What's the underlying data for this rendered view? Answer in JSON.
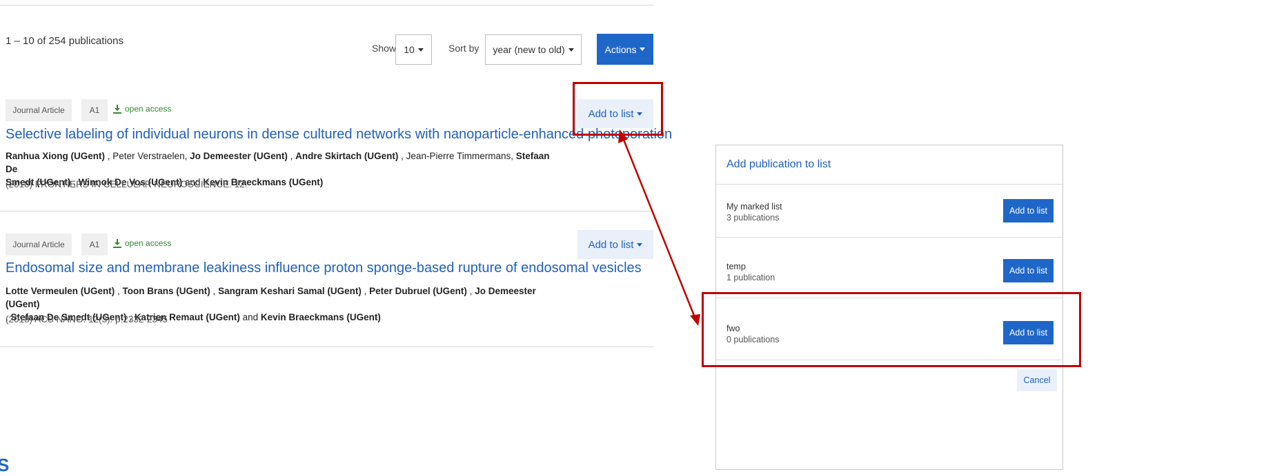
{
  "results": {
    "count_text": "1 – 10 of 254 publications",
    "show_label": "Show",
    "show_value": "10",
    "sort_label": "Sort by",
    "sort_value": "year (new to old)",
    "actions_label": "Actions"
  },
  "publications": [
    {
      "type": "Journal Article",
      "classification": "A1",
      "access": "open access",
      "add_to_list": "Add to list",
      "title": "Selective labeling of individual neurons in dense cultured networks with nanoparticle-enhanced photoporation",
      "authors_line1": [
        {
          "name": "Ranhua Xiong (UGent)",
          "ugent": true
        },
        {
          "name": " , ",
          "ugent": false
        },
        {
          "name": "Peter Verstraelen, ",
          "ugent": false
        },
        {
          "name": "Jo Demeester (UGent)",
          "ugent": true
        },
        {
          "name": " , ",
          "ugent": false
        },
        {
          "name": "Andre Skirtach (UGent)",
          "ugent": true
        },
        {
          "name": " , Jean-Pierre Timmermans, ",
          "ugent": false
        },
        {
          "name": "Stefaan De",
          "ugent": true
        }
      ],
      "authors_line2": [
        {
          "name": "Smedt (UGent)",
          "ugent": true
        },
        {
          "name": " , ",
          "ugent": false
        },
        {
          "name": "Winnok De Vos (UGent)",
          "ugent": true
        },
        {
          "name": " and ",
          "ugent": false
        },
        {
          "name": "Kevin Braeckmans (UGent)",
          "ugent": true
        }
      ],
      "source": "(2018) FRONTIERS IN CELLULAR NEUROSCIENCE. 12."
    },
    {
      "type": "Journal Article",
      "classification": "A1",
      "access": "open access",
      "add_to_list": "Add to list",
      "title": "Endosomal size and membrane leakiness influence proton sponge-based rupture of endosomal vesicles",
      "authors_line1": [
        {
          "name": "Lotte Vermeulen (UGent)",
          "ugent": true
        },
        {
          "name": " , ",
          "ugent": false
        },
        {
          "name": "Toon Brans (UGent)",
          "ugent": true
        },
        {
          "name": " , ",
          "ugent": false
        },
        {
          "name": "Sangram Keshari Samal (UGent)",
          "ugent": true
        },
        {
          "name": " , ",
          "ugent": false
        },
        {
          "name": "Peter Dubruel (UGent)",
          "ugent": true
        },
        {
          "name": " , ",
          "ugent": false
        },
        {
          "name": "Jo Demeester (UGent)",
          "ugent": true
        }
      ],
      "authors_line2": [
        {
          "name": ", ",
          "ugent": false
        },
        {
          "name": "Stefaan De Smedt (UGent)",
          "ugent": true
        },
        {
          "name": " , ",
          "ugent": false
        },
        {
          "name": "Katrien Remaut (UGent)",
          "ugent": true
        },
        {
          "name": " and ",
          "ugent": false
        },
        {
          "name": "Kevin Braeckmans (UGent)",
          "ugent": true
        }
      ],
      "source": "(2018) ACS NANO. 12(3). p.2332-2345"
    }
  ],
  "modal": {
    "title": "Add publication to list",
    "lists": [
      {
        "name": "My marked list",
        "count": "3 publications",
        "button": "Add to list"
      },
      {
        "name": "temp",
        "count": "1 publication",
        "button": "Add to list"
      },
      {
        "name": "fwo",
        "count": "0 publications",
        "button": "Add to list"
      }
    ],
    "cancel": "Cancel"
  },
  "logo_glyph": "S",
  "colors": {
    "accent": "#1f66c9",
    "link": "#1f5fbf",
    "annotation": "#c00000",
    "open_access": "#2f8a2f"
  }
}
